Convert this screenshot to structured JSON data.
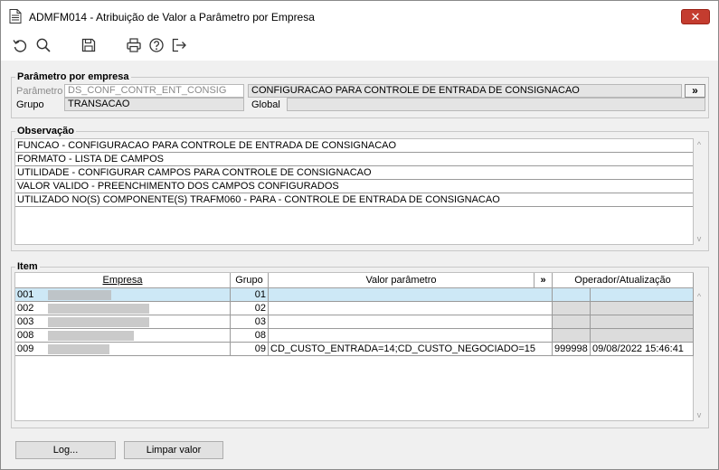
{
  "window": {
    "title": "ADMFM014 - Atribuição de Valor a Parâmetro por Empresa",
    "close_label": "✕"
  },
  "toolbar": {
    "icons": [
      "undo-icon",
      "search-icon",
      "save-icon",
      "print-icon",
      "help-icon",
      "exit-icon"
    ]
  },
  "parametro_section": {
    "legend": "Parâmetro por empresa",
    "parametro_label": "Parâmetro",
    "parametro_value": "DS_CONF_CONTR_ENT_CONSIG",
    "parametro_description": "CONFIGURACAO PARA CONTROLE DE ENTRADA DE CONSIGNACAO",
    "expand_label": "»",
    "grupo_label": "Grupo",
    "grupo_value": "TRANSACAO",
    "global_label": "Global",
    "global_value": ""
  },
  "observacao": {
    "legend": "Observação",
    "lines": [
      "FUNCAO - CONFIGURACAO PARA CONTROLE DE ENTRADA DE CONSIGNACAO",
      "FORMATO - LISTA DE CAMPOS",
      "UTILIDADE - CONFIGURAR CAMPOS PARA CONTROLE DE CONSIGNACAO",
      "VALOR VALIDO - PREENCHIMENTO DOS CAMPOS CONFIGURADOS",
      "UTILIZADO NO(S) COMPONENTE(S) TRAFM060 - PARA - CONTROLE DE ENTRADA DE CONSIGNACAO"
    ]
  },
  "item": {
    "legend": "Item",
    "columns": {
      "empresa": "Empresa",
      "grupo": "Grupo",
      "valor": "Valor parâmetro",
      "expand": "»",
      "operador": "Operador/Atualização"
    },
    "rows": [
      {
        "codigo": "001",
        "grupo": "01",
        "valor": "",
        "operador": "",
        "atualizacao": ""
      },
      {
        "codigo": "002",
        "grupo": "02",
        "valor": "",
        "operador": "",
        "atualizacao": ""
      },
      {
        "codigo": "003",
        "grupo": "03",
        "valor": "",
        "operador": "",
        "atualizacao": ""
      },
      {
        "codigo": "008",
        "grupo": "08",
        "valor": "",
        "operador": "",
        "atualizacao": ""
      },
      {
        "codigo": "009",
        "grupo": "09",
        "valor": "CD_CUSTO_ENTRADA=14;CD_CUSTO_NEGOCIADO=15",
        "operador": "999998",
        "atualizacao": "09/08/2022 15:46:41"
      }
    ]
  },
  "buttons": {
    "log": "Log...",
    "limpar": "Limpar valor"
  },
  "colors": {
    "selection": "#cde8f6",
    "close": "#c43c2f"
  }
}
